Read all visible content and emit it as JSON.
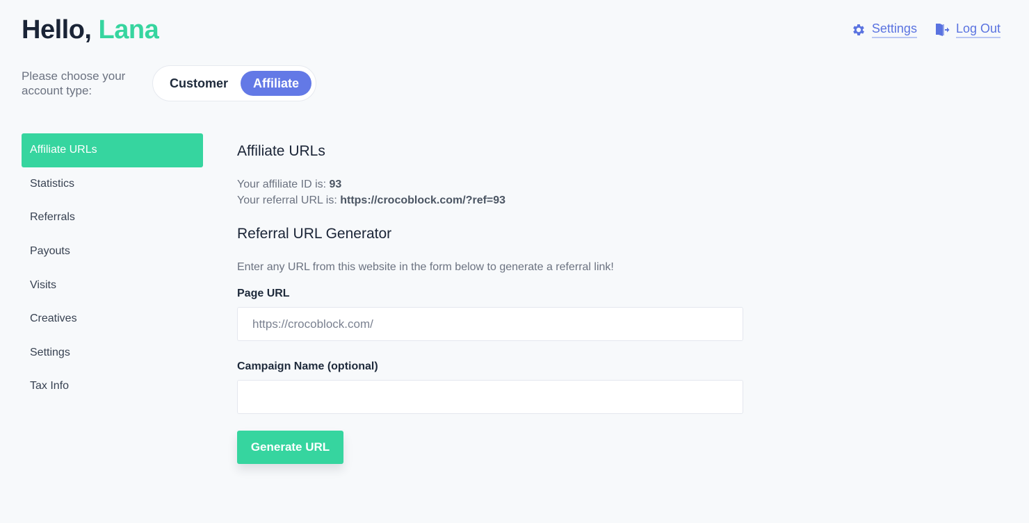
{
  "header": {
    "greeting": "Hello,",
    "user_name": "Lana",
    "settings_label": "Settings",
    "logout_label": "Log Out",
    "settings_icon": "gear-icon",
    "logout_icon": "door-exit-icon"
  },
  "account_type": {
    "prompt": "Please choose your account type:",
    "options": [
      "Customer",
      "Affiliate"
    ],
    "selected": "Affiliate"
  },
  "sidebar": {
    "items": [
      {
        "label": "Affiliate URLs",
        "active": true
      },
      {
        "label": "Statistics",
        "active": false
      },
      {
        "label": "Referrals",
        "active": false
      },
      {
        "label": "Payouts",
        "active": false
      },
      {
        "label": "Visits",
        "active": false
      },
      {
        "label": "Creatives",
        "active": false
      },
      {
        "label": "Settings",
        "active": false
      },
      {
        "label": "Tax Info",
        "active": false
      }
    ]
  },
  "main": {
    "title": "Affiliate URLs",
    "affiliate_id_label": "Your affiliate ID is:",
    "affiliate_id": "93",
    "referral_url_label": "Your referral URL is:",
    "referral_url": "https://crocoblock.com/?ref=93",
    "generator_title": "Referral URL Generator",
    "generator_description": "Enter any URL from this website in the form below to generate a referral link!",
    "page_url_label": "Page URL",
    "page_url_placeholder": "https://crocoblock.com/",
    "page_url_value": "",
    "campaign_label": "Campaign Name (optional)",
    "campaign_placeholder": "",
    "campaign_value": "",
    "generate_button": "Generate URL"
  },
  "colors": {
    "accent_green": "#36d59f",
    "accent_blue": "#6379e6",
    "background": "#f7f9fb",
    "text_dark": "#1a2436"
  }
}
